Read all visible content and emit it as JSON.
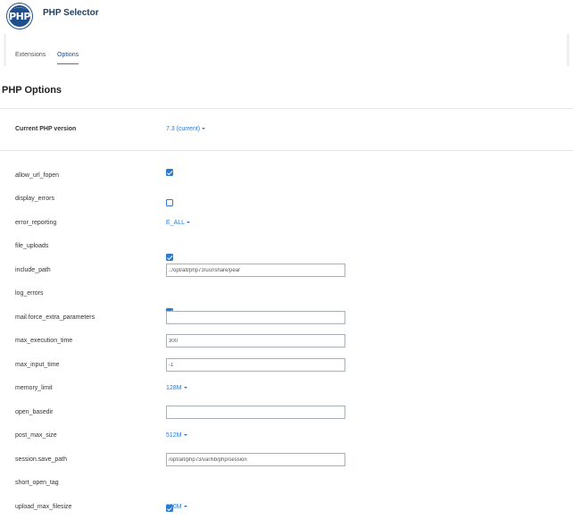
{
  "app": {
    "title": "PHP Selector",
    "logo_text": "PHP"
  },
  "tabs": [
    {
      "label": "Extensions",
      "active": false
    },
    {
      "label": "Options",
      "active": true
    }
  ],
  "section_title": "PHP Options",
  "current_version": {
    "label": "Current PHP version",
    "value": "7.3 (current)"
  },
  "options": [
    {
      "label": "allow_url_fopen",
      "type": "checkbox",
      "checked": true
    },
    {
      "label": "display_errors",
      "type": "checkbox",
      "checked": false
    },
    {
      "label": "error_reporting",
      "type": "dropdown",
      "value": "E_ALL"
    },
    {
      "label": "file_uploads",
      "type": "checkbox",
      "checked": true
    },
    {
      "label": "include_path",
      "type": "input",
      "value": ".:/opt/alt/php73/usr/share/pear"
    },
    {
      "label": "log_errors",
      "type": "checkbox",
      "checked": true
    },
    {
      "label": "mail.force_extra_parameters",
      "type": "input",
      "value": ""
    },
    {
      "label": "max_execution_time",
      "type": "input",
      "value": "300"
    },
    {
      "label": "max_input_time",
      "type": "input",
      "value": "-1"
    },
    {
      "label": "memory_limit",
      "type": "dropdown",
      "value": "128M"
    },
    {
      "label": "open_basedir",
      "type": "input",
      "value": ""
    },
    {
      "label": "post_max_size",
      "type": "dropdown",
      "value": "512M"
    },
    {
      "label": "session.save_path",
      "type": "input",
      "value": "/opt/alt/php73/var/lib/php/session"
    },
    {
      "label": "short_open_tag",
      "type": "checkbox",
      "checked": true
    },
    {
      "label": "upload_max_filesize",
      "type": "dropdown",
      "value": "200M"
    }
  ],
  "colors": {
    "accent": "#2b7bd3",
    "brand": "#1f4e8c"
  }
}
